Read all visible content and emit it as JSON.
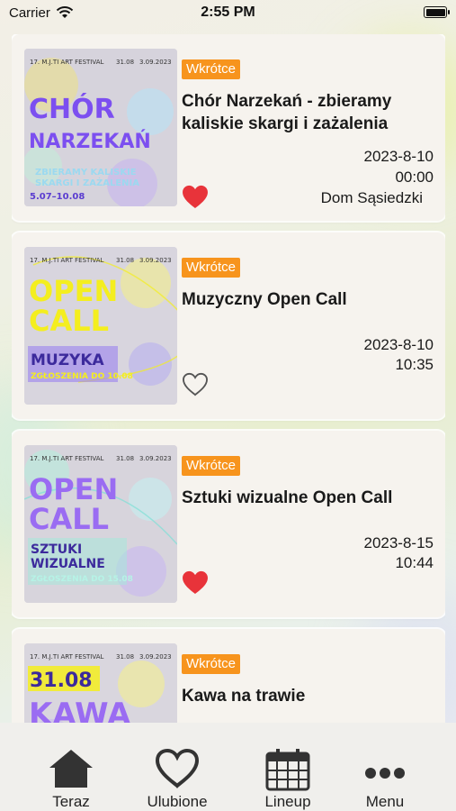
{
  "status": {
    "carrier": "Carrier",
    "time": "2:55 PM"
  },
  "events": [
    {
      "badge": "Wkrótce",
      "title": "Chór Narzekań - zbieramy kaliskie skargi i zażalenia",
      "date": "2023-8-10",
      "time": "00:00",
      "place": "Dom Sąsiedzki",
      "favorite": true,
      "poster": {
        "festival": "17. M.J.TI ART FESTIVAL",
        "dates": "31.08",
        "year": "3.09.2023",
        "line1": "CHÓR",
        "line2": "NARZEKAŃ",
        "sub1": "ZBIERAMY KALISKIE",
        "sub2": "SKARGI I ZAŻALENIA",
        "footer": "5.07–10.08"
      }
    },
    {
      "badge": "Wkrótce",
      "title": "Muzyczny Open Call",
      "date": "2023-8-10",
      "time": "10:35",
      "place": "",
      "favorite": false,
      "poster": {
        "festival": "17. M.J.TI ART FESTIVAL",
        "dates": "31.08",
        "year": "3.09.2023",
        "line1": "OPEN",
        "line2": "CALL",
        "sub1": "MUZYKA",
        "sub2": "",
        "footer": "ZGŁOSZENIA DO 10.08"
      }
    },
    {
      "badge": "Wkrótce",
      "title": "Sztuki wizualne Open Call",
      "date": "2023-8-15",
      "time": "10:44",
      "place": "",
      "favorite": true,
      "poster": {
        "festival": "17. M.J.TI ART FESTIVAL",
        "dates": "31.08",
        "year": "3.09.2023",
        "line1": "OPEN",
        "line2": "CALL",
        "sub1": "SZTUKI",
        "sub2": "WIZUALNE",
        "footer": "ZGŁOSZENIA DO 15.08"
      }
    },
    {
      "badge": "Wkrótce",
      "title": "Kawa na trawie",
      "date": "",
      "time": "",
      "place": "",
      "favorite": false,
      "poster": {
        "festival": "17. M.J.TI ART FESTIVAL",
        "dates": "31.08",
        "year": "3.09.2023",
        "line1": "31.08",
        "line2": "KAWA",
        "sub1": "",
        "sub2": "",
        "footer": ""
      }
    }
  ],
  "tabs": [
    {
      "label": "Teraz",
      "icon": "home-icon"
    },
    {
      "label": "Ulubione",
      "icon": "heart-icon"
    },
    {
      "label": "Lineup",
      "icon": "calendar-icon"
    },
    {
      "label": "Menu",
      "icon": "more-icon"
    }
  ],
  "colors": {
    "badge": "#f7941d",
    "heart": "#e8333a",
    "poster_purple": "#8b5cf6",
    "poster_yellow": "#f4ee1f"
  }
}
